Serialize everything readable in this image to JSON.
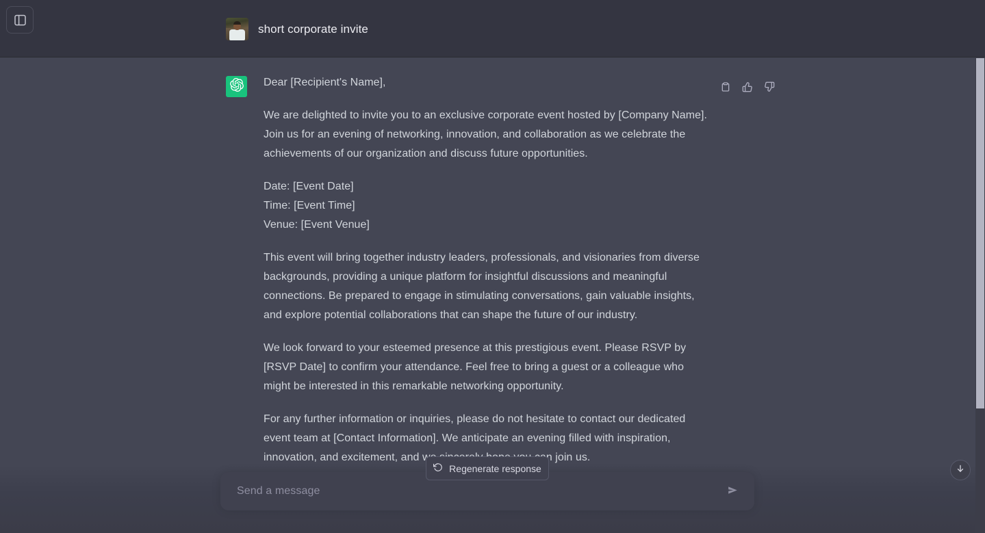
{
  "header": {
    "sidebar_toggle_name": "sidebar-toggle-icon",
    "conversation_title": "short corporate invite",
    "avatar_alt": "user-avatar-photo"
  },
  "message": {
    "bot_icon": "openai-logo-icon",
    "actions": [
      {
        "name": "copy-button",
        "icon": "clipboard-icon",
        "label": "Copy"
      },
      {
        "name": "thumbs-up-button",
        "icon": "thumbs-up-icon",
        "label": "Good response"
      },
      {
        "name": "thumbs-down-button",
        "icon": "thumbs-down-icon",
        "label": "Bad response"
      }
    ],
    "paragraphs": {
      "greeting": "Dear [Recipient's Name],",
      "p1": "We are delighted to invite you to an exclusive corporate event hosted by [Company Name]. Join us for an evening of networking, innovation, and collaboration as we celebrate the achievements of our organization and discuss future opportunities.",
      "detail_date": "Date: [Event Date]",
      "detail_time": "Time: [Event Time]",
      "detail_venue": "Venue: [Event Venue]",
      "p2": "This event will bring together industry leaders, professionals, and visionaries from diverse backgrounds, providing a unique platform for insightful discussions and meaningful connections. Be prepared to engage in stimulating conversations, gain valuable insights, and explore potential collaborations that can shape the future of our industry.",
      "p3": "We look forward to your esteemed presence at this prestigious event. Please RSVP by [RSVP Date] to confirm your attendance. Feel free to bring a guest or a colleague who might be interested in this remarkable networking opportunity.",
      "p4": "For any further information or inquiries, please do not hesitate to contact our dedicated event team at [Contact Information]. We anticipate an evening filled with inspiration, innovation, and excitement, and we sincerely hope you can join us."
    }
  },
  "regenerate": {
    "label": "Regenerate response",
    "icon": "refresh-icon"
  },
  "scroll_to_bottom": {
    "icon": "arrow-down-icon"
  },
  "composer": {
    "placeholder": "Send a message",
    "value": "",
    "send_icon": "send-arrow-icon"
  },
  "colors": {
    "header_bg": "#343541",
    "body_bg": "#444654",
    "brand_green": "#19c37d",
    "text": "#d1d5db",
    "muted_text": "#8e8ea0",
    "composer_bg": "#40414f",
    "scrollbar_thumb": "#b3b4c2"
  }
}
